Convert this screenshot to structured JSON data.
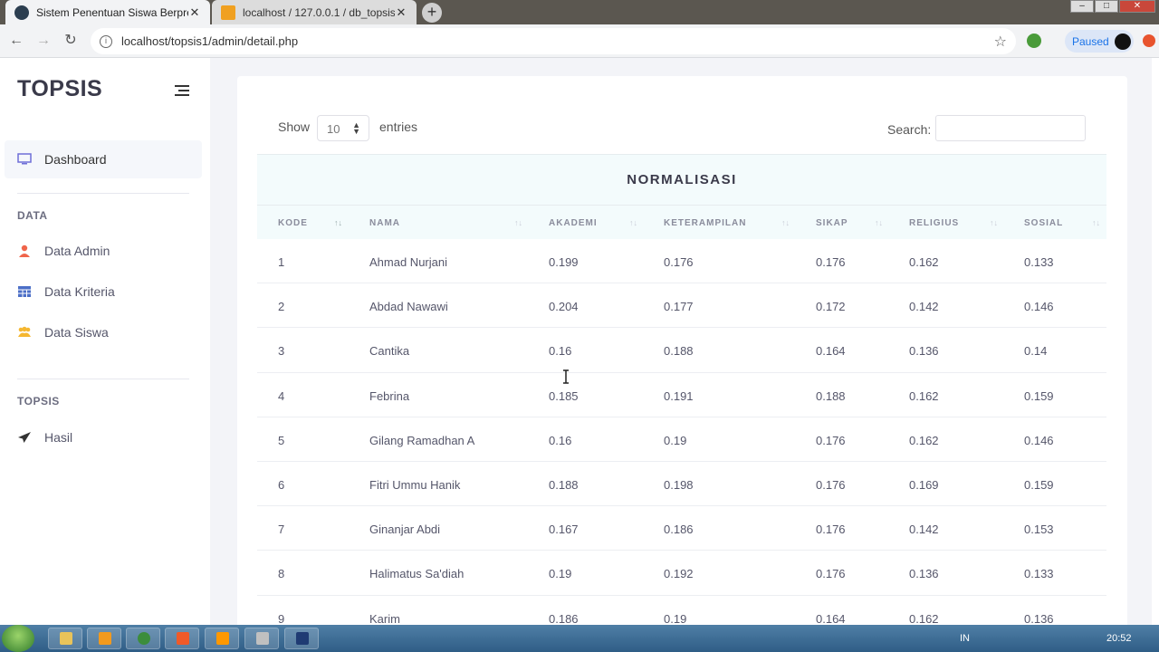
{
  "browser": {
    "tabs": [
      {
        "title": "Sistem Penentuan Siswa Berprestasi",
        "active": true
      },
      {
        "title": "localhost / 127.0.0.1 / db_topsis",
        "active": false
      }
    ],
    "url": "localhost/topsis1/admin/detail.php",
    "profile_status": "Paused"
  },
  "sidebar": {
    "brand": "TOPSIS",
    "dashboard": "Dashboard",
    "section_data": "DATA",
    "items_data": [
      "Data Admin",
      "Data Kriteria",
      "Data Siswa"
    ],
    "section_topsis": "TOPSIS",
    "items_topsis": [
      "Hasil"
    ]
  },
  "table_controls": {
    "show_label": "Show",
    "page_size": "10",
    "entries_label": "entries",
    "search_label": "Search:"
  },
  "table": {
    "title": "NORMALISASI",
    "columns": [
      "KODE",
      "NAMA",
      "AKADEMI",
      "KETERAMPILAN",
      "SIKAP",
      "RELIGIUS",
      "SOSIAL"
    ],
    "rows": [
      [
        "1",
        "Ahmad Nurjani",
        "0.199",
        "0.176",
        "0.176",
        "0.162",
        "0.133"
      ],
      [
        "2",
        "Abdad Nawawi",
        "0.204",
        "0.177",
        "0.172",
        "0.142",
        "0.146"
      ],
      [
        "3",
        "Cantika",
        "0.16",
        "0.188",
        "0.164",
        "0.136",
        "0.14"
      ],
      [
        "4",
        "Febrina",
        "0.185",
        "0.191",
        "0.188",
        "0.162",
        "0.159"
      ],
      [
        "5",
        "Gilang Ramadhan A",
        "0.16",
        "0.19",
        "0.176",
        "0.162",
        "0.146"
      ],
      [
        "6",
        "Fitri Ummu Hanik",
        "0.188",
        "0.198",
        "0.176",
        "0.169",
        "0.159"
      ],
      [
        "7",
        "Ginanjar Abdi",
        "0.167",
        "0.186",
        "0.176",
        "0.142",
        "0.153"
      ],
      [
        "8",
        "Halimatus Sa'diah",
        "0.19",
        "0.192",
        "0.176",
        "0.136",
        "0.133"
      ],
      [
        "9",
        "Karim",
        "0.186",
        "0.19",
        "0.164",
        "0.162",
        "0.136"
      ]
    ]
  },
  "taskbar": {
    "language": "IN",
    "clock": "20:52"
  },
  "colors": {
    "accent_blue": "#1a73e8",
    "table_header_bg": "#f3fbfc",
    "content_bg": "#f3f4f8"
  }
}
